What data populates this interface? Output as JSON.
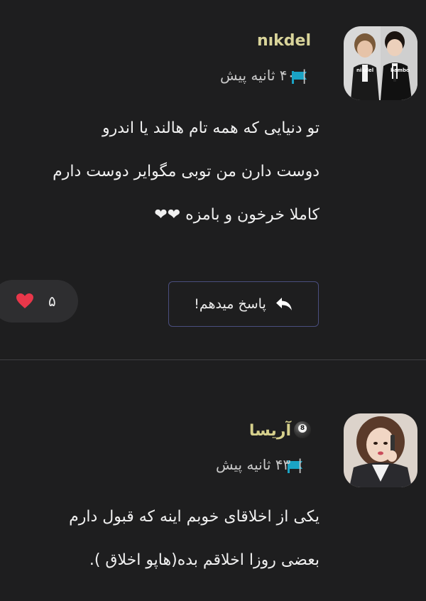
{
  "comments": [
    {
      "username": "nıkdel",
      "time_label": "۴۰ ثانیه پیش",
      "lines": [
        "تو دنیایی که همه تام هالند یا اندرو",
        "دوست دارن من توبی مگوایر دوست دارم",
        "کاملا خرخون و بامزه ❤❤"
      ],
      "like_count": "۵",
      "reply_label": "پاسخ میدهم!",
      "avatar_labels": [
        "nikdel",
        "bambo"
      ]
    },
    {
      "username": "آریسا",
      "time_label": "۴۳ ثانیه پیش",
      "lines": [
        "یکی از اخلاقای خوبم اینه که قبول دارم",
        "بعضی روزا اخلاقم بده(هاپو اخلاق )."
      ]
    }
  ],
  "meta_separator": "|",
  "colors": {
    "background": "#1e1e1f",
    "username": "#d9d49a",
    "flag": "#1aa3c4",
    "heart": "#e8374a",
    "reply_border": "#4a4e7e"
  },
  "icons": {
    "flag": "flag-icon",
    "heart": "heart-icon",
    "reply": "reply-arrow-icon",
    "badge": "eight-ball-icon"
  }
}
